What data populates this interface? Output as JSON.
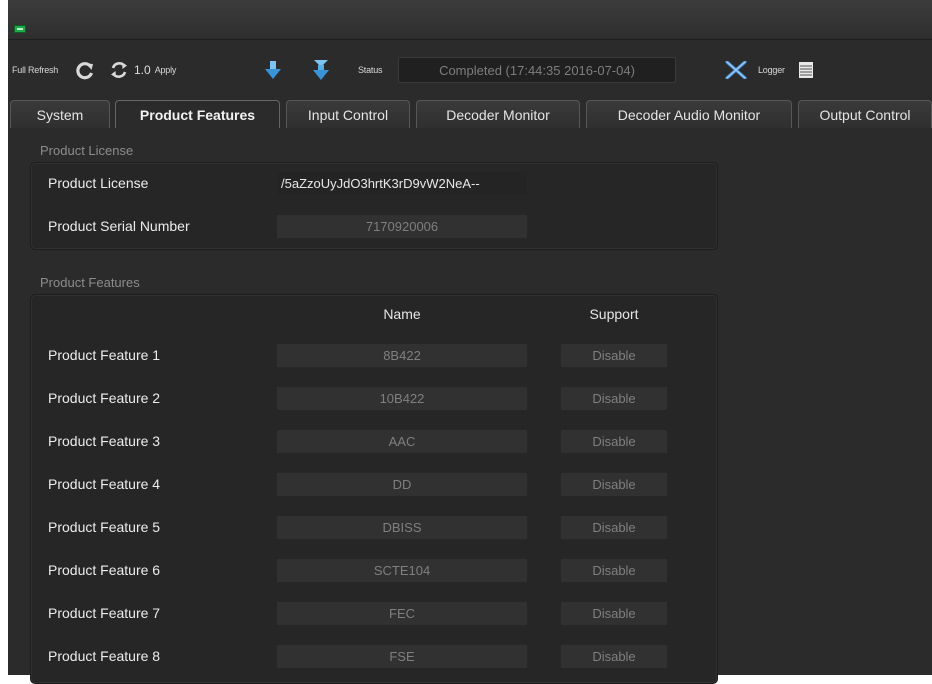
{
  "toolbar": {
    "full_refresh_label": "Full Refresh",
    "apply_value": "1.0",
    "apply_label": "Apply",
    "status_label": "Status",
    "status_value": "Completed  (17:44:35  2016-07-04)",
    "logger_label": "Logger"
  },
  "tabs": [
    {
      "label": "System"
    },
    {
      "label": "Product Features",
      "active": true
    },
    {
      "label": "Input Control"
    },
    {
      "label": "Decoder Monitor"
    },
    {
      "label": "Decoder Audio Monitor"
    },
    {
      "label": "Output Control"
    }
  ],
  "license_section": {
    "title": "Product License",
    "license_label": "Product License",
    "license_value": "/5aZzoUyJdO3hrtK3rD9vW2NeA--",
    "serial_label": "Product Serial Number",
    "serial_value": "7170920006"
  },
  "features_section": {
    "title": "Product Features",
    "col_name": "Name",
    "col_support": "Support",
    "rows": [
      {
        "label": "Product Feature 1",
        "name": "8B422",
        "support": "Disable"
      },
      {
        "label": "Product Feature 2",
        "name": "10B422",
        "support": "Disable"
      },
      {
        "label": "Product Feature 3",
        "name": "AAC",
        "support": "Disable"
      },
      {
        "label": "Product Feature 4",
        "name": "DD",
        "support": "Disable"
      },
      {
        "label": "Product Feature 5",
        "name": "DBISS",
        "support": "Disable"
      },
      {
        "label": "Product Feature 6",
        "name": "SCTE104",
        "support": "Disable"
      },
      {
        "label": "Product Feature 7",
        "name": "FEC",
        "support": "Disable"
      },
      {
        "label": "Product Feature 8",
        "name": "FSE",
        "support": "Disable"
      }
    ]
  },
  "colors": {
    "background": "#2b2b2b",
    "accent_blue": "#4aa8e8",
    "refresh_icon": "#d9d9d9",
    "close_icon": "#4a90d9",
    "app_icon": "#1ea84a"
  },
  "icons": [
    "app-icon",
    "full-refresh-icon",
    "refresh-icon",
    "download-icon",
    "download-all-icon",
    "close-icon",
    "logger-icon"
  ]
}
